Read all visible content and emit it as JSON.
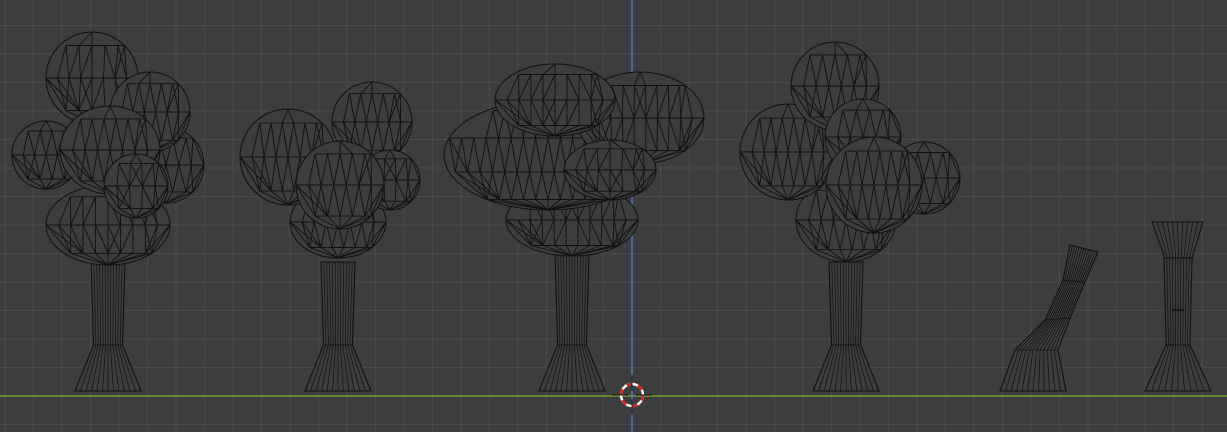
{
  "viewport": {
    "view": "front-orthographic",
    "mode": "wireframe",
    "background_color": "#3d3d3d",
    "grid_color": "#4a4a4a",
    "x_axis_color": "#7a9a3a",
    "z_axis_color": "#4a78c0",
    "wire_color": "#111111"
  },
  "objects": [
    {
      "name": "tree-1",
      "icon": "tree-mesh"
    },
    {
      "name": "tree-2",
      "icon": "tree-mesh"
    },
    {
      "name": "tree-3",
      "icon": "tree-mesh"
    },
    {
      "name": "tree-4",
      "icon": "tree-mesh"
    },
    {
      "name": "bent-trunk",
      "icon": "trunk-mesh"
    },
    {
      "name": "straight-trunk",
      "icon": "trunk-mesh"
    }
  ],
  "cursor": {
    "icon": "3d-cursor-icon",
    "color_a": "#d22222",
    "color_b": "#ffffff"
  }
}
